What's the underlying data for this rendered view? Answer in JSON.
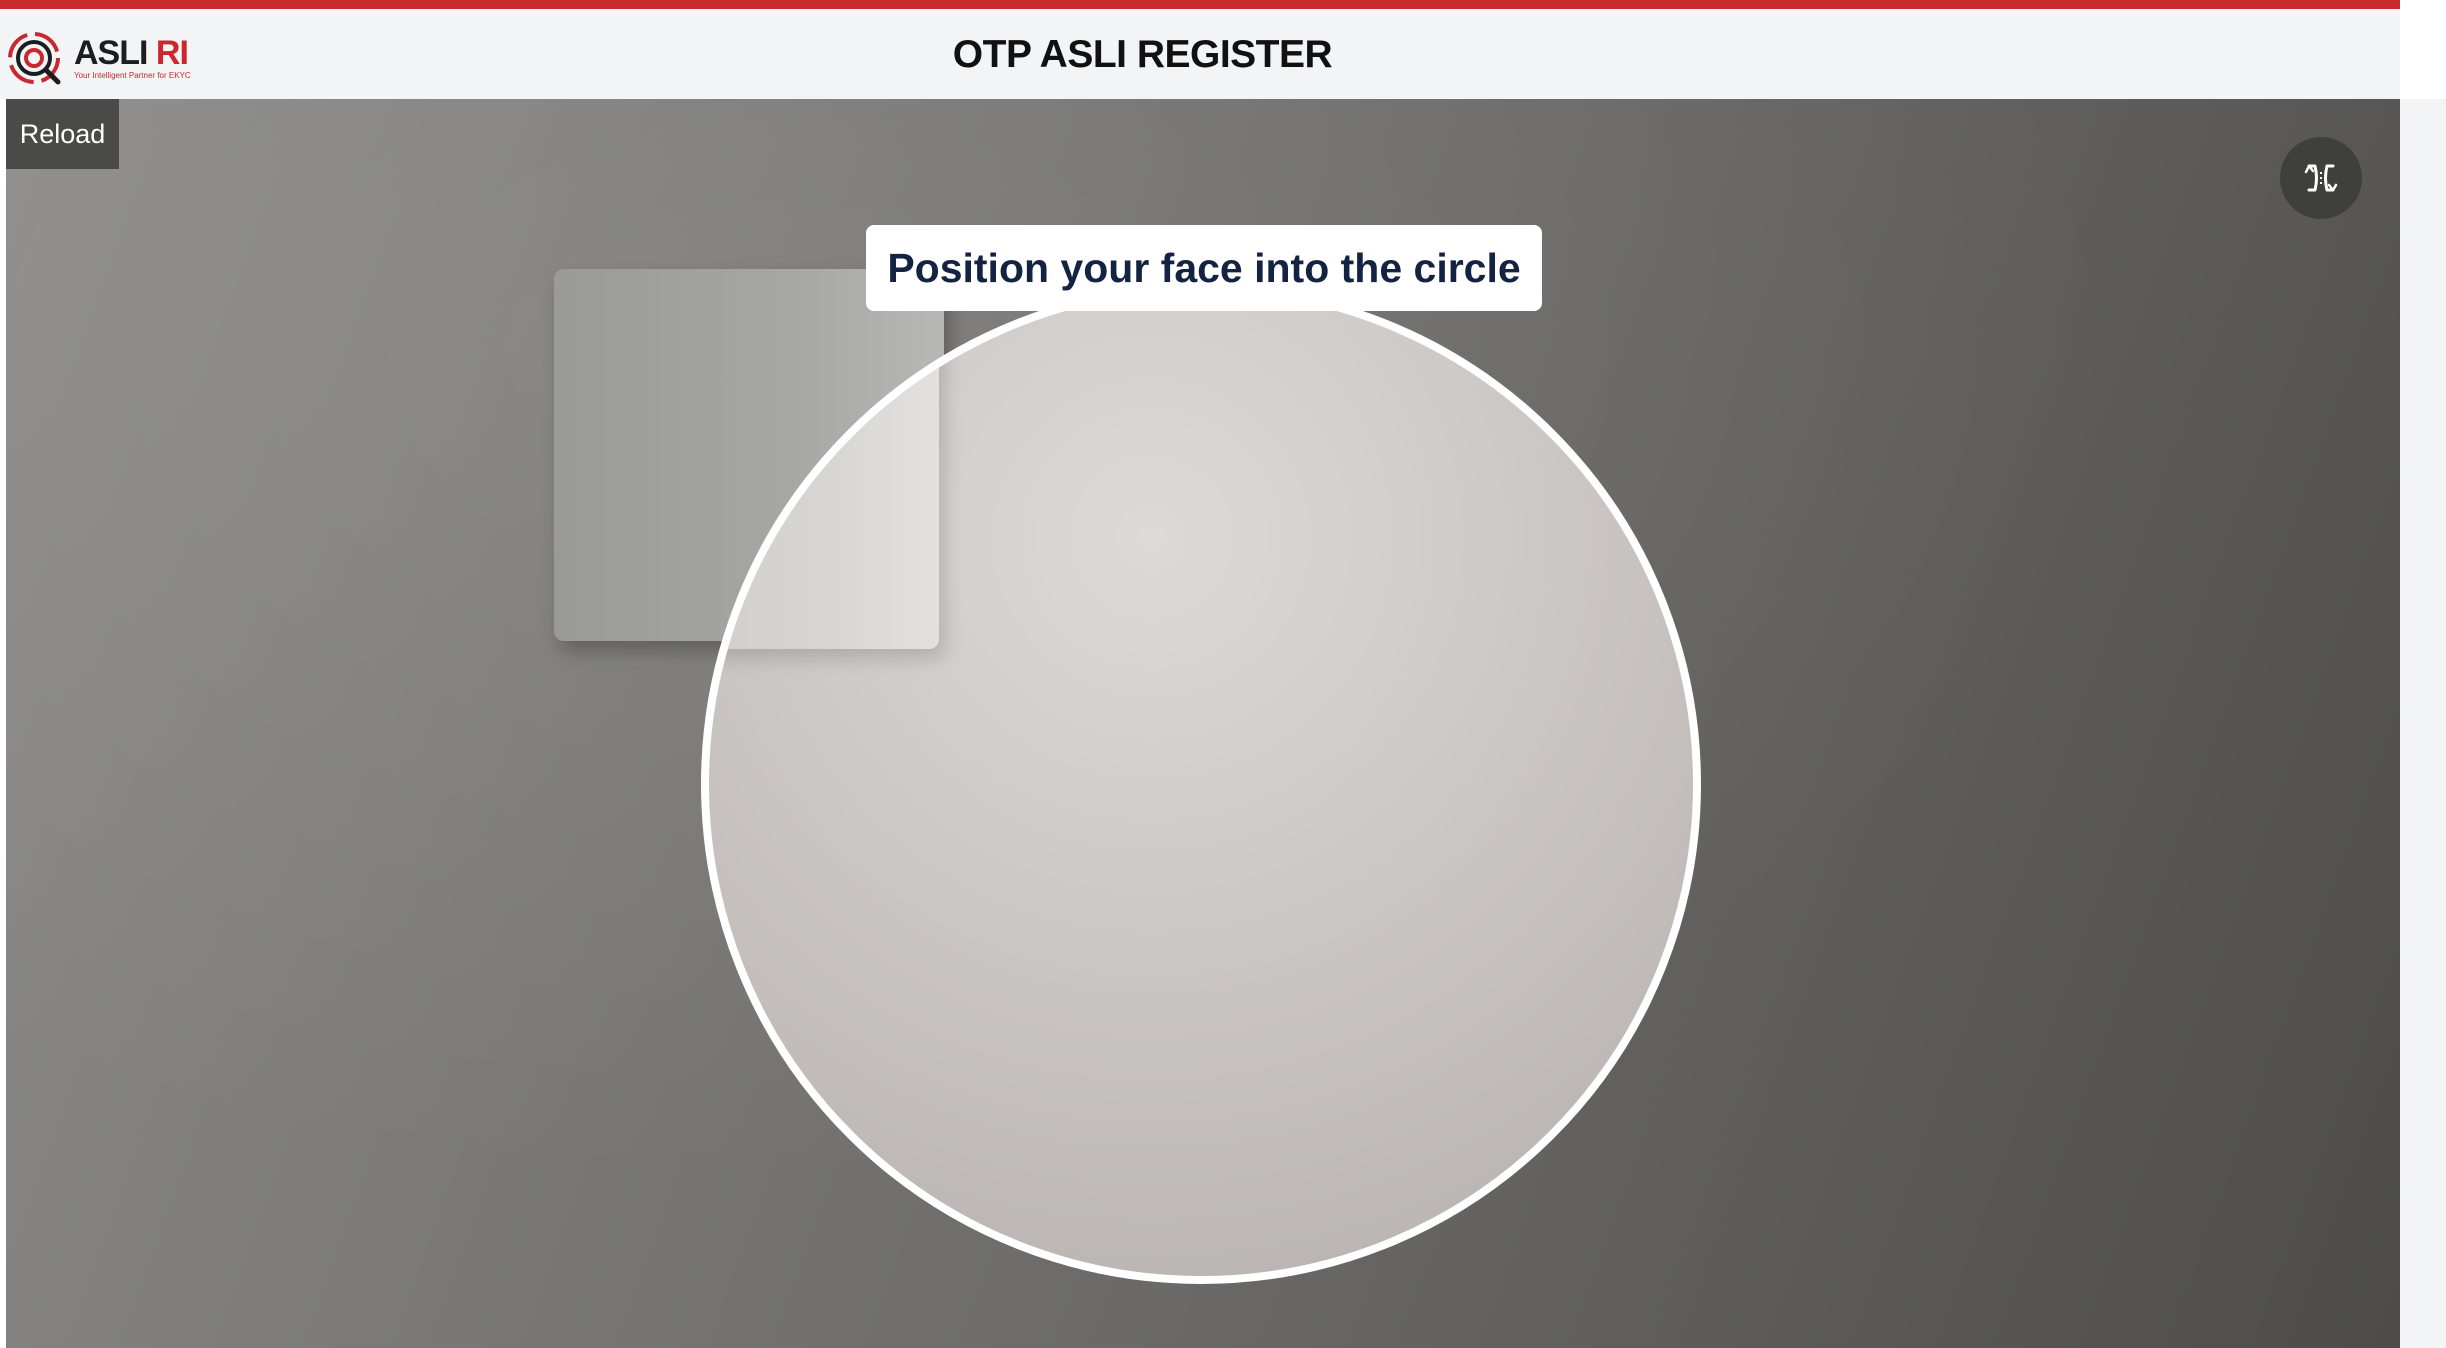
{
  "header": {
    "logo_name_main": "ASLI",
    "logo_name_accent": "RI",
    "logo_tagline": "Your Intelligent Partner for EKYC",
    "title": "OTP ASLI REGISTER"
  },
  "camera": {
    "reload_label": "Reload",
    "flip_icon": "flip-camera-icon",
    "instruction": "Position your face into the circle"
  },
  "colors": {
    "accent": "#c8282e",
    "instruction_text": "#142342",
    "header_bg": "#f3f4f6"
  }
}
